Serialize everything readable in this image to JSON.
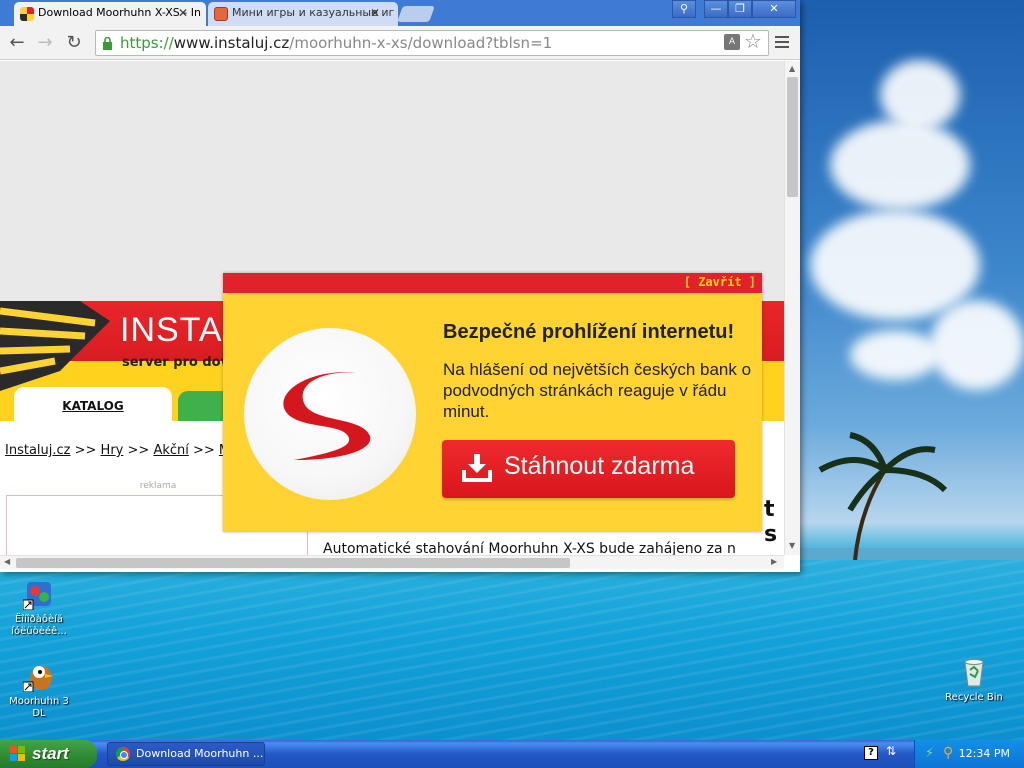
{
  "browser": {
    "tabs": [
      {
        "title": "Download Moorhuhn X-XS - In",
        "active": true
      },
      {
        "title": "Мини игры и казуальные иг",
        "active": false
      }
    ],
    "url": {
      "scheme": "https://",
      "host": "www.instaluj.cz",
      "path": "/moorhuhn-x-xs/download?tblsn=1"
    },
    "window_buttons": {
      "minimize": "—",
      "restore": "❐",
      "close": "✕"
    }
  },
  "page": {
    "site_name": "INSTALUJ",
    "site_sub": "server pro dow",
    "nav": {
      "katalog": "KATALOG"
    },
    "breadcrumb": [
      {
        "text": "Instaluj.cz",
        "link": true
      },
      {
        "text": " >> ",
        "link": false
      },
      {
        "text": "Hry",
        "link": true
      },
      {
        "text": " >> ",
        "link": false
      },
      {
        "text": "Akční",
        "link": true
      },
      {
        "text": " >> ",
        "link": false
      },
      {
        "text": "M",
        "link": true
      }
    ],
    "ad_label": "reklama",
    "download_message": "Automatické stahování Moorhuhn X-XS bude zahájeno za n",
    "title_fragment": "t s"
  },
  "popup": {
    "close": "[ Zavřít ]",
    "heading": "Bezpečné prohlížení internetu!",
    "body": "Na hlášení od největších českých bank o podvodných stránkách reaguje v řádu minut.",
    "button": "Stáhnout zdarma",
    "brand_color": "#e1222a",
    "background_color": "#fed332"
  },
  "desktop": {
    "icons": [
      {
        "label": "Ëîíîðàôèíã íóëüòèéê...",
        "icon": "shortcut-app-icon"
      },
      {
        "label": "Moorhuhn 3 DL",
        "icon": "moorhuhn-icon"
      },
      {
        "label": "Recycle Bin",
        "icon": "recycle-bin-icon"
      }
    ]
  },
  "taskbar": {
    "start": "start",
    "tasks": [
      {
        "title": "Download Moorhuhn ..."
      }
    ],
    "clock": "12:34 PM"
  }
}
